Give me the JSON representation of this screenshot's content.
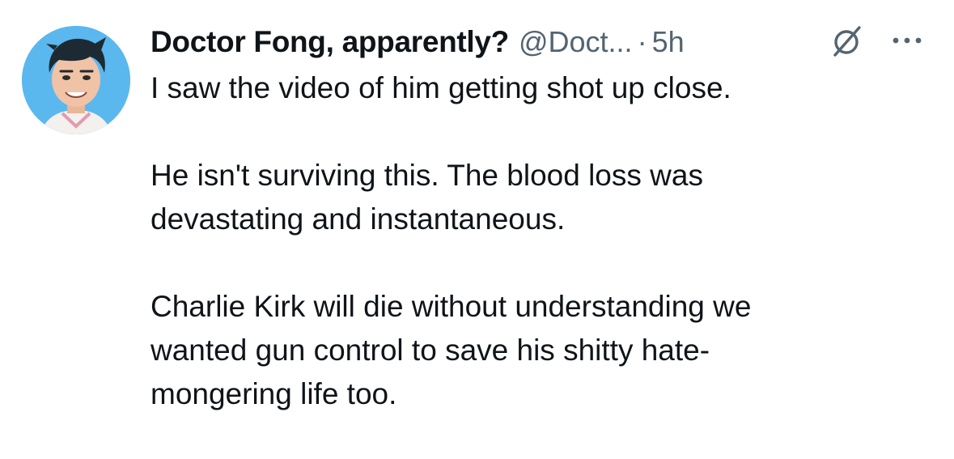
{
  "tweet": {
    "author": {
      "display_name": "Doctor Fong, apparently?",
      "handle": "@Doct...",
      "avatar_icon": "cartoon-avatar"
    },
    "separator": "·",
    "time_ago": "5h",
    "grok_icon": "grok-icon",
    "more_icon": "more-icon",
    "paragraphs": [
      {
        "lines": [
          "I saw the video of him getting shot up close."
        ]
      },
      {
        "lines": [
          "He isn't surviving this. The blood loss was",
          "devastating and instantaneous."
        ]
      },
      {
        "lines": [
          "Charlie Kirk will die without understanding we",
          "wanted gun control to save his shitty hate-",
          "mongering life too."
        ]
      }
    ]
  },
  "colors": {
    "text_primary": "#0f1419",
    "text_secondary": "#536471",
    "avatar_background": "#5bb8ee"
  }
}
